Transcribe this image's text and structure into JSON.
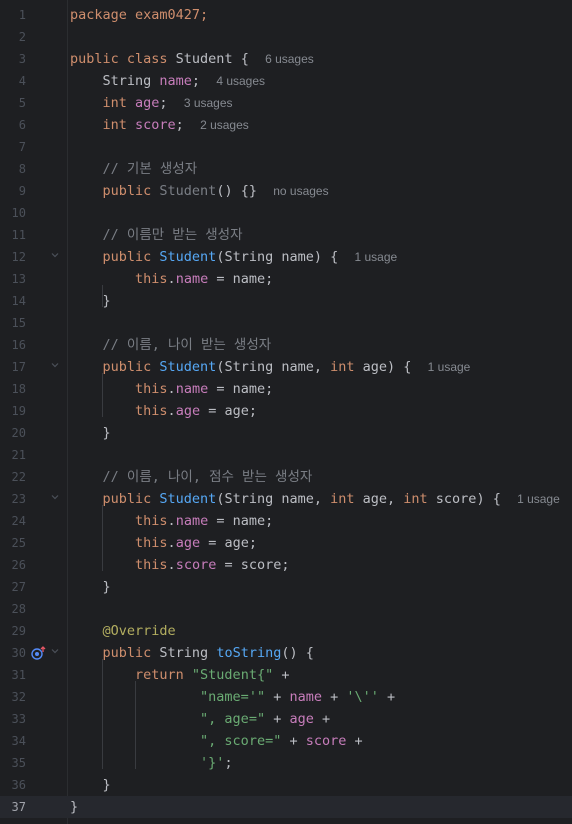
{
  "editor": {
    "current_line": 37,
    "lines": [
      {
        "num": "1",
        "s1": "package exam0427;"
      },
      {
        "num": "2"
      },
      {
        "num": "3",
        "s1": "public class ",
        "s2": "Student {  ",
        "s3": "6 usages"
      },
      {
        "num": "4",
        "s1": "    String ",
        "s2": "name",
        "s3": ";  ",
        "s4": "4 usages"
      },
      {
        "num": "5",
        "s1": "    int ",
        "s2": "age",
        "s3": ";  ",
        "s4": "3 usages"
      },
      {
        "num": "6",
        "s1": "    int ",
        "s2": "score",
        "s3": ";  ",
        "s4": "2 usages"
      },
      {
        "num": "7"
      },
      {
        "num": "8",
        "s1": "    // 기본 생성자"
      },
      {
        "num": "9",
        "s1": "    public ",
        "s2": "Student",
        "s3": "() {}  ",
        "s4": "no usages"
      },
      {
        "num": "10"
      },
      {
        "num": "11",
        "s1": "    // 이름만 받는 생성자"
      },
      {
        "num": "12",
        "s1": "    public ",
        "s2": "Student",
        "s3": "(String name) {  ",
        "s4": "1 usage"
      },
      {
        "num": "13",
        "s1": "        this",
        "s2": ".",
        "s3": "name",
        "s4": " = name;"
      },
      {
        "num": "14",
        "s1": "    }"
      },
      {
        "num": "15"
      },
      {
        "num": "16",
        "s1": "    // 이름, 나이 받는 생성자"
      },
      {
        "num": "17",
        "s1": "    public ",
        "s2": "Student",
        "s3": "(String name, ",
        "s4": "int",
        "s5": " age) {  ",
        "s6": "1 usage"
      },
      {
        "num": "18",
        "s1": "        this",
        "s2": ".",
        "s3": "name",
        "s4": " = name;"
      },
      {
        "num": "19",
        "s1": "        this",
        "s2": ".",
        "s3": "age",
        "s4": " = age;"
      },
      {
        "num": "20",
        "s1": "    }"
      },
      {
        "num": "21"
      },
      {
        "num": "22",
        "s1": "    // 이름, 나이, 점수 받는 생성자"
      },
      {
        "num": "23",
        "s1": "    public ",
        "s2": "Student",
        "s3": "(String name, ",
        "s4": "int",
        "s5": " age, ",
        "s6": "int",
        "s7": " score) {  ",
        "s8": "1 usage"
      },
      {
        "num": "24",
        "s1": "        this",
        "s2": ".",
        "s3": "name",
        "s4": " = name;"
      },
      {
        "num": "25",
        "s1": "        this",
        "s2": ".",
        "s3": "age",
        "s4": " = age;"
      },
      {
        "num": "26",
        "s1": "        this",
        "s2": ".",
        "s3": "score",
        "s4": " = score;"
      },
      {
        "num": "27",
        "s1": "    }"
      },
      {
        "num": "28"
      },
      {
        "num": "29",
        "s1": "    @Override"
      },
      {
        "num": "30",
        "s1": "    public ",
        "s2": "String ",
        "s3": "toString",
        "s4": "() {"
      },
      {
        "num": "31",
        "s1": "        return ",
        "s2": "\"Student{\"",
        "s3": " +"
      },
      {
        "num": "32",
        "s1": "                ",
        "s2": "\"name='\"",
        "s3": " + ",
        "s4": "name",
        "s5": " + ",
        "s6": "'\\''",
        "s7": " +"
      },
      {
        "num": "33",
        "s1": "                ",
        "s2": "\", age=\"",
        "s3": " + ",
        "s4": "age",
        "s5": " +"
      },
      {
        "num": "34",
        "s1": "                ",
        "s2": "\", score=\"",
        "s3": " + ",
        "s4": "score",
        "s5": " +"
      },
      {
        "num": "35",
        "s1": "                ",
        "s2": "'}'",
        "s3": ";"
      },
      {
        "num": "36",
        "s1": "    }"
      },
      {
        "num": "37",
        "s1": "}"
      }
    ]
  },
  "colors": {
    "background": "#1e1f22",
    "keyword": "#cf8e6d",
    "field": "#c77dbb",
    "method": "#56a8f5",
    "string": "#6aab73",
    "comment": "#7a7e85",
    "annotation": "#b3ae60",
    "inlay_hint": "#868a91",
    "text": "#bcbec4"
  },
  "icons": {
    "override": "override-method-icon",
    "fold": "fold-chevron-icon"
  }
}
